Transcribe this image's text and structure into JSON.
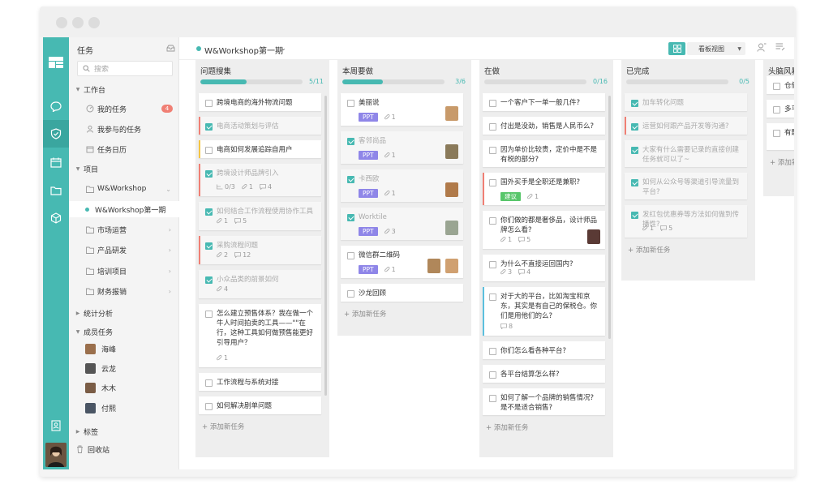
{
  "sidebar": {
    "title": "任务",
    "search_placeholder": "搜索",
    "workspace": "工作台",
    "my_tasks": "我的任务",
    "my_tasks_badge": "4",
    "participated": "我参与的任务",
    "calendar": "任务日历",
    "projects": "项目",
    "project_items": [
      "W&Workshop",
      "W&Workshop第一期",
      "市场运营",
      "产品研发",
      "培训项目",
      "财务报销"
    ],
    "stats": "统计分析",
    "members": "成员任务",
    "member_names": [
      "海峰",
      "云龙",
      "木木",
      "付熙"
    ],
    "tags": "标签",
    "trash": "回收站"
  },
  "header": {
    "project": "W&Workshop第一期",
    "view_label": "看板视图"
  },
  "add_task": "+ 添加新任务",
  "columns": [
    {
      "title": "问题搜集",
      "count": "5/11",
      "progress": 0.45,
      "cards": [
        {
          "text": "跨境电商的海外物流问题",
          "done": false
        },
        {
          "text": "电商活动策划与评估",
          "done": true,
          "stripe": "#f07f74"
        },
        {
          "text": "电商如何发展追踪自用户",
          "done": false,
          "stripe": "#f5c542"
        },
        {
          "text": "跨境设计师品牌引入",
          "done": true,
          "stripe": "#f07f74",
          "meta": {
            "sub": "0/3",
            "att": "1",
            "cmt": "4"
          }
        },
        {
          "text": "如何结合工作流程使用协作工具",
          "done": true,
          "meta": {
            "att": "1",
            "cmt": "5"
          }
        },
        {
          "text": "采购流程问题",
          "done": true,
          "stripe": "#f07f74",
          "meta": {
            "att": "2",
            "cmt": "12"
          }
        },
        {
          "text": "小众品类的前景如何",
          "done": true,
          "meta": {
            "att": "4"
          }
        },
        {
          "text": "怎么建立预售体系？我在做一个牛人时间拍卖的工具——\"\"在行，这种工具如何做预售能更好引导用户？",
          "done": false,
          "meta": {
            "att": "1"
          }
        },
        {
          "text": "工作流程与系统对接",
          "done": false
        },
        {
          "text": "如何解决剧单问题",
          "done": false
        }
      ]
    },
    {
      "title": "本周要做",
      "count": "3/6",
      "progress": 0.4,
      "cards": [
        {
          "text": "美丽说",
          "done": false,
          "tag": "PPT",
          "meta": {
            "att": "1"
          }
        },
        {
          "text": "客邻尚品",
          "done": true,
          "tag": "PPT",
          "meta": {
            "att": "1"
          }
        },
        {
          "text": "卡西欧",
          "done": true,
          "tag": "PPT",
          "meta": {
            "att": "1"
          }
        },
        {
          "text": "Worktile",
          "done": true,
          "tag": "PPT",
          "meta": {
            "att": "3"
          }
        },
        {
          "text": "微信群二维码",
          "done": false,
          "tag": "PPT",
          "meta": {
            "att": "1"
          }
        },
        {
          "text": "沙龙回顾",
          "done": false
        }
      ]
    },
    {
      "title": "在做",
      "count": "0/16",
      "progress": 0,
      "cards": [
        {
          "text": "一个客户下一单一般几件?",
          "done": false
        },
        {
          "text": "付出是没劲，销售是人民币么?",
          "done": false
        },
        {
          "text": "因为单价比较贵，定价中是不是有税的部分?",
          "done": false
        },
        {
          "text": "国外买手是全职还是兼职?",
          "done": false,
          "stripe": "#f07f74",
          "tag": "建议",
          "meta": {
            "att": "1"
          }
        },
        {
          "text": "你们做的都是奢侈品，设计师品牌怎么看?",
          "done": false,
          "meta": {
            "att": "1",
            "cmt": "5"
          }
        },
        {
          "text": "为什么不直接运回国内?",
          "done": false,
          "meta": {
            "att": "3",
            "cmt": "4"
          }
        },
        {
          "text": "对于大的平台，比如淘宝和京东，其实是有自己的保税仓。你们是用他们的么?",
          "done": false,
          "stripe": "#5bc0de",
          "meta": {
            "cmt": "8"
          }
        },
        {
          "text": "你们怎么看各种平台?",
          "done": false
        },
        {
          "text": "各平台结算怎么样?",
          "done": false
        },
        {
          "text": "如何了解一个品牌的销售情况? 是不是适合销售?",
          "done": false
        }
      ]
    },
    {
      "title": "已完成",
      "count": "0/5",
      "progress": 0,
      "cards": [
        {
          "text": "加车转化问题",
          "done": true
        },
        {
          "text": "运营如何跟产品开发等沟通?",
          "done": true,
          "stripe": "#f07f74"
        },
        {
          "text": "大家有什么需要记录的直接创建任务就可以了~",
          "done": true
        },
        {
          "text": "如何从公众号等渠道引导流量到平台?",
          "done": true
        },
        {
          "text": "发红包优惠券等方法如何做到传播性?",
          "done": true,
          "meta": {
            "att": "1",
            "cmt": "5"
          }
        }
      ]
    },
    {
      "title": "头脑风暴",
      "cards": [
        {
          "text": "仓储",
          "done": false
        },
        {
          "text": "多平",
          "done": false
        },
        {
          "text": "有题有什",
          "done": false
        }
      ]
    }
  ]
}
